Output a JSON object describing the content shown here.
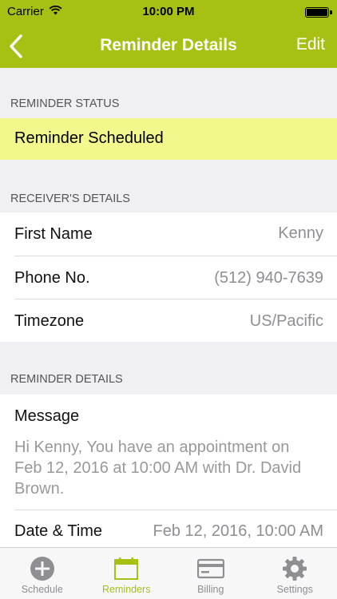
{
  "status_bar": {
    "carrier": "Carrier",
    "time": "10:00 PM"
  },
  "nav": {
    "title": "Reminder Details",
    "edit_label": "Edit"
  },
  "sections": {
    "status_header": "REMINDER STATUS",
    "status_value": "Reminder Scheduled",
    "receiver_header": "RECEIVER'S DETAILS",
    "details_header": "REMINDER DETAILS"
  },
  "receiver": {
    "first_name_label": "First Name",
    "first_name_value": "Kenny",
    "phone_label": "Phone No.",
    "phone_value": "(512) 940-7639",
    "timezone_label": "Timezone",
    "timezone_value": "US/Pacific"
  },
  "details": {
    "message_label": "Message",
    "message_value": "Hi Kenny, You have an appointment on Feb 12, 2016 at 10:00 AM with Dr. David Brown.",
    "datetime_label": "Date & Time",
    "datetime_value": "Feb 12, 2016, 10:00 AM"
  },
  "tabs": [
    {
      "label": "Schedule",
      "icon": "plus-circle-icon"
    },
    {
      "label": "Reminders",
      "icon": "calendar-icon",
      "active": true
    },
    {
      "label": "Billing",
      "icon": "credit-card-icon"
    },
    {
      "label": "Settings",
      "icon": "gear-icon"
    }
  ],
  "colors": {
    "accent": "#a8bf14",
    "status_highlight": "#f2f88c",
    "background": "#efeff4"
  }
}
